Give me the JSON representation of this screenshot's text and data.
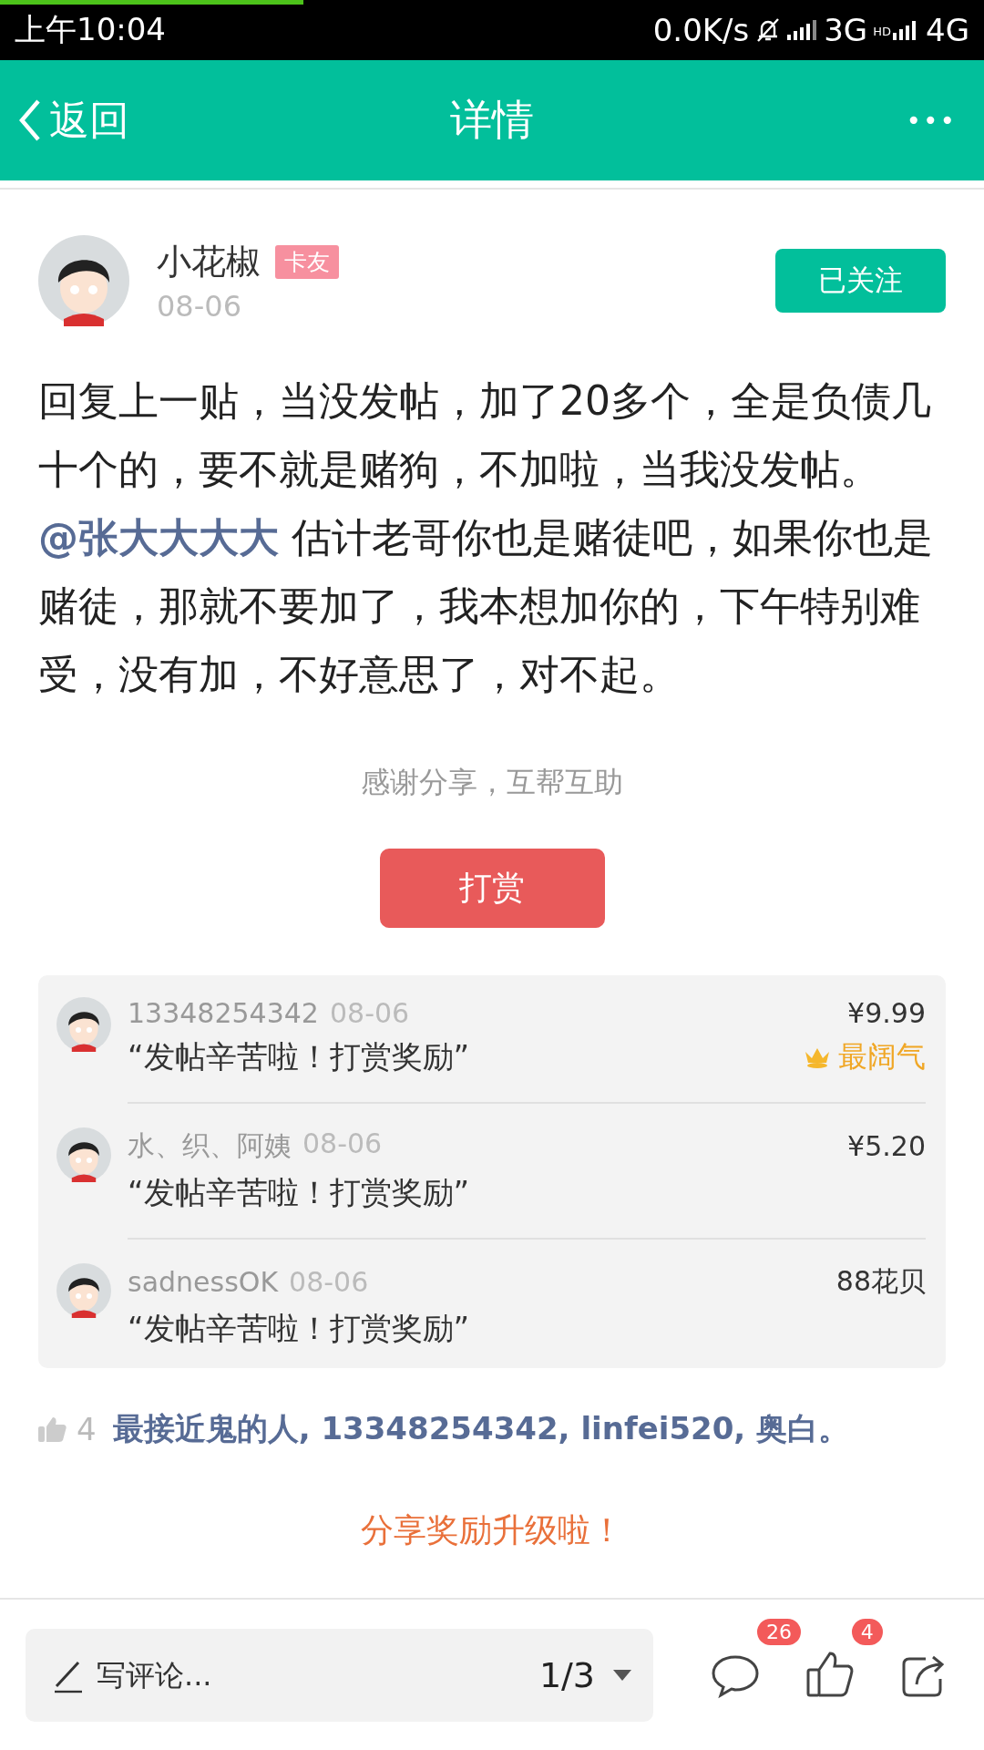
{
  "status_bar": {
    "time": "上午10:04",
    "speed": "0.0K/s",
    "network_1": "3G",
    "hd": "HD",
    "network_2": "4G"
  },
  "header": {
    "back": "返回",
    "title": "详情",
    "more": "•••"
  },
  "author": {
    "name": "小花椒",
    "badge": "卡友",
    "date": "08-06",
    "follow": "已关注"
  },
  "post": {
    "paragraphs": [
      [
        {
          "kind": "text",
          "text": "回复上一贴，当没发帖，加了20多个，全是负债几十个的，要不就是赌狗，不加啦，当我没发帖。"
        }
      ],
      [
        {
          "kind": "mention",
          "text": "@张大大大大"
        },
        {
          "kind": "text",
          "text": " 估计老哥你也是赌徒吧，如果你也是赌徒，那就不要加了，我本想加你的，下午特别难受，没有加，不好意思了，对不起。"
        }
      ]
    ]
  },
  "thanks": "感谢分享，互帮互助",
  "reward_button": "打赏",
  "rewards": [
    {
      "name": "13348254342",
      "date": "08-06",
      "message": "“发帖辛苦啦！打赏奖励”",
      "amount": "¥9.99",
      "tag": "最阔气"
    },
    {
      "name": "水、织、阿姨",
      "date": "08-06",
      "message": "“发帖辛苦啦！打赏奖励”",
      "amount": "¥5.20"
    },
    {
      "name": "sadnessOK",
      "date": "08-06",
      "message": "“发帖辛苦啦！打赏奖励”",
      "amount": "88花贝"
    }
  ],
  "likes": {
    "count": "4",
    "names": "最接近鬼的人, 13348254342, linfei520, 奥白。"
  },
  "promo": "分享奖励升级啦！",
  "bottom_bar": {
    "comment_placeholder": "写评论...",
    "pager": "1/3",
    "comment_count": "26",
    "like_count": "4"
  }
}
